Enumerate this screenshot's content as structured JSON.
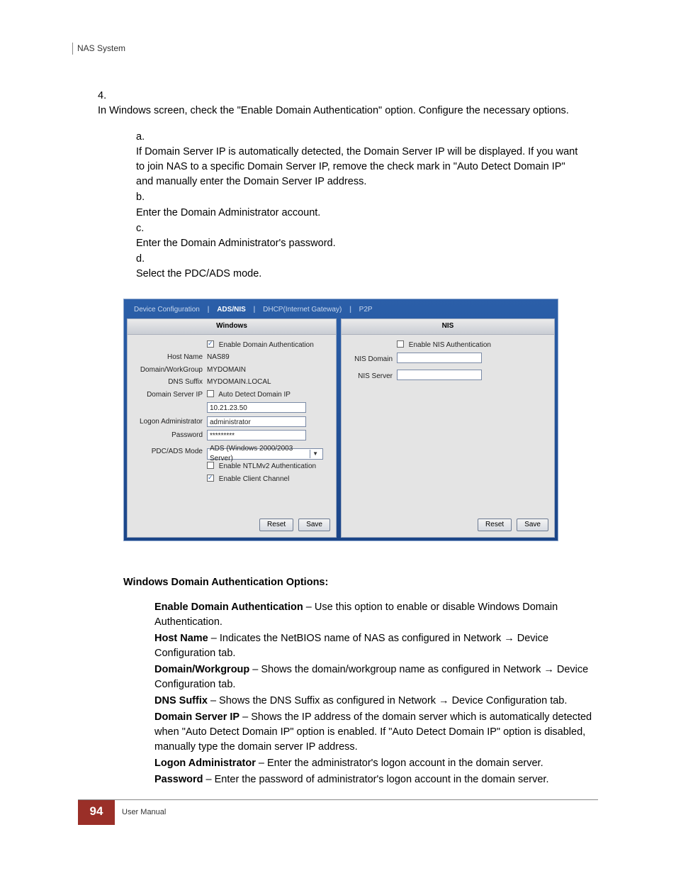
{
  "header": "NAS System",
  "step4": {
    "num": "4.",
    "text": "In Windows screen, check the \"Enable Domain Authentication\" option. Configure the necessary options."
  },
  "subs": [
    {
      "let": "a.",
      "text": "If Domain Server IP is automatically detected, the Domain Server IP will be displayed. If you want to join NAS to a specific Domain Server IP, remove the check mark in \"Auto Detect Domain IP\" and manually enter the Domain Server IP address."
    },
    {
      "let": "b.",
      "text": "Enter the Domain Administrator account."
    },
    {
      "let": "c.",
      "text": "Enter the Domain Administrator's password."
    },
    {
      "let": "d.",
      "text": "Select the PDC/ADS mode."
    }
  ],
  "tabs": {
    "t1": "Device Configuration",
    "t2": "ADS/NIS",
    "t3": "DHCP(Internet Gateway)",
    "t4": "P2P",
    "sep": "|"
  },
  "panelL": {
    "head": "Windows",
    "enable": "Enable Domain Authentication",
    "rows": {
      "hostname_l": "Host Name",
      "hostname_v": "NAS89",
      "domain_l": "Domain/WorkGroup",
      "domain_v": "MYDOMAIN",
      "dns_l": "DNS Suffix",
      "dns_v": "MYDOMAIN.LOCAL",
      "dsip_l": "Domain Server IP",
      "dsip_chk": "Auto Detect Domain IP",
      "dsip_v": "10.21.23.50",
      "admin_l": "Logon Administrator",
      "admin_v": "administrator",
      "pass_l": "Password",
      "pass_v": "*********",
      "mode_l": "PDC/ADS Mode",
      "mode_v": "ADS (Windows 2000/2003 Server)",
      "ntlm": "Enable NTLMv2 Authentication",
      "client": "Enable Client Channel"
    },
    "reset": "Reset",
    "save": "Save"
  },
  "panelR": {
    "head": "NIS",
    "enable": "Enable NIS Authentication",
    "nisdomain_l": "NIS Domain",
    "nisserver_l": "NIS Server",
    "reset": "Reset",
    "save": "Save"
  },
  "sec_head": "Windows Domain Authentication Options:",
  "defs": [
    {
      "term": "Enable Domain Authentication",
      "rest": " – Use this option to enable or disable Windows Domain Authentication."
    },
    {
      "term": "Host Name",
      "rest": " – Indicates the NetBIOS name of NAS as configured in Network → Device Configuration tab."
    },
    {
      "term": "Domain/Workgroup",
      "rest": " – Shows the domain/workgroup name as configured in Network → Device Configuration tab."
    },
    {
      "term": "DNS Suffix",
      "rest": " – Shows the DNS Suffix as configured in Network → Device Configuration tab."
    },
    {
      "term": "Domain Server IP",
      "rest": " – Shows the IP address of the domain server which is automatically detected when \"Auto Detect Domain IP\" option is enabled. If \"Auto Detect Domain IP\" option is disabled, manually type the domain server IP address."
    },
    {
      "term": "Logon Administrator",
      "rest": " – Enter the administrator's logon account in the domain server."
    },
    {
      "term": "Password",
      "rest": " – Enter the password of administrator's logon account in the domain server."
    }
  ],
  "footer": {
    "page": "94",
    "manual": "User Manual"
  }
}
